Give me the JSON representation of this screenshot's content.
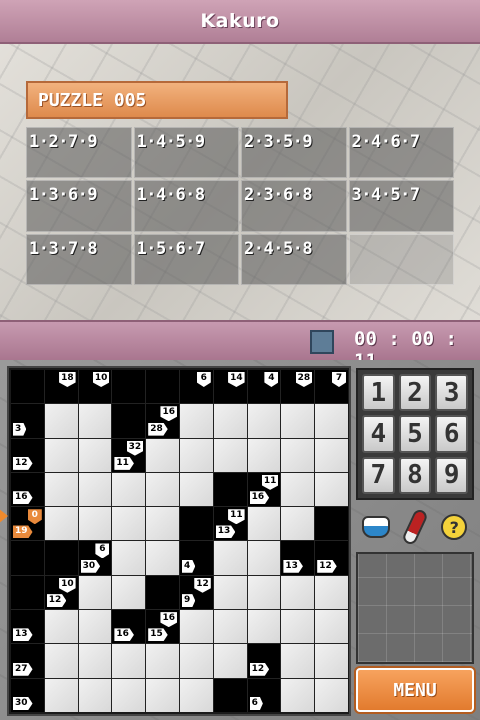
{
  "header": {
    "title": "Kakuro"
  },
  "puzzle": {
    "label": "PUZZLE 005"
  },
  "combinations": [
    "1·2·7·9",
    "1·4·5·9",
    "2·3·5·9",
    "2·4·6·7",
    "1·3·6·9",
    "1·4·6·8",
    "2·3·6·8",
    "3·4·5·7",
    "1·3·7·8",
    "1·5·6·7",
    "2·4·5·8",
    ""
  ],
  "timer": {
    "value": "00 : 00 : 11"
  },
  "keypad": {
    "keys": [
      "1",
      "2",
      "3",
      "4",
      "5",
      "6",
      "7",
      "8",
      "9"
    ]
  },
  "tools": {
    "hint_symbol": "?"
  },
  "menu": {
    "label": "MENU"
  },
  "colors": {
    "accent": "#e27b2e",
    "title_bar": "#b07f96"
  },
  "board": {
    "rows": 10,
    "cols": 10,
    "cells": [
      [
        {
          "t": "b"
        },
        {
          "t": "b",
          "d": "18"
        },
        {
          "t": "b",
          "d": "10"
        },
        {
          "t": "b"
        },
        {
          "t": "b"
        },
        {
          "t": "b",
          "d": "6"
        },
        {
          "t": "b",
          "d": "14"
        },
        {
          "t": "b",
          "d": "4"
        },
        {
          "t": "b",
          "d": "28"
        },
        {
          "t": "b",
          "d": "7"
        }
      ],
      [
        {
          "t": "b",
          "r": "3"
        },
        {
          "t": "w"
        },
        {
          "t": "w"
        },
        {
          "t": "b"
        },
        {
          "t": "b",
          "d": "16",
          "r": "28"
        },
        {
          "t": "w"
        },
        {
          "t": "w"
        },
        {
          "t": "w"
        },
        {
          "t": "w"
        },
        {
          "t": "w"
        }
      ],
      [
        {
          "t": "b",
          "r": "12"
        },
        {
          "t": "w"
        },
        {
          "t": "w"
        },
        {
          "t": "b",
          "d": "32",
          "r": "11"
        },
        {
          "t": "w"
        },
        {
          "t": "w"
        },
        {
          "t": "w"
        },
        {
          "t": "w"
        },
        {
          "t": "w"
        },
        {
          "t": "w"
        }
      ],
      [
        {
          "t": "b",
          "r": "16"
        },
        {
          "t": "w"
        },
        {
          "t": "w"
        },
        {
          "t": "w"
        },
        {
          "t": "w"
        },
        {
          "t": "w"
        },
        {
          "t": "b"
        },
        {
          "t": "b",
          "d": "11",
          "r": "16"
        },
        {
          "t": "w"
        },
        {
          "t": "w"
        }
      ],
      [
        {
          "t": "b",
          "r": "19",
          "d": "0",
          "hi": true
        },
        {
          "t": "w"
        },
        {
          "t": "w"
        },
        {
          "t": "w"
        },
        {
          "t": "w"
        },
        {
          "t": "b"
        },
        {
          "t": "b",
          "d": "11",
          "r": "13"
        },
        {
          "t": "w"
        },
        {
          "t": "w"
        },
        {
          "t": "b"
        }
      ],
      [
        {
          "t": "b"
        },
        {
          "t": "b"
        },
        {
          "t": "b",
          "d": "6",
          "r": "30"
        },
        {
          "t": "w"
        },
        {
          "t": "w"
        },
        {
          "t": "b",
          "r": "4"
        },
        {
          "t": "w"
        },
        {
          "t": "w"
        },
        {
          "t": "b",
          "r": "13"
        },
        {
          "t": "b",
          "r": "12"
        }
      ],
      [
        {
          "t": "b"
        },
        {
          "t": "b",
          "d": "10",
          "r": "12"
        },
        {
          "t": "w"
        },
        {
          "t": "w"
        },
        {
          "t": "b"
        },
        {
          "t": "b",
          "d": "12",
          "r": "9"
        },
        {
          "t": "w"
        },
        {
          "t": "w"
        },
        {
          "t": "w"
        },
        {
          "t": "w"
        }
      ],
      [
        {
          "t": "b",
          "r": "13"
        },
        {
          "t": "w"
        },
        {
          "t": "w"
        },
        {
          "t": "b",
          "r": "16"
        },
        {
          "t": "b",
          "d": "16",
          "r": "15"
        },
        {
          "t": "w"
        },
        {
          "t": "w"
        },
        {
          "t": "w"
        },
        {
          "t": "w"
        },
        {
          "t": "w"
        }
      ],
      [
        {
          "t": "b",
          "r": "27"
        },
        {
          "t": "w"
        },
        {
          "t": "w"
        },
        {
          "t": "w"
        },
        {
          "t": "w"
        },
        {
          "t": "w"
        },
        {
          "t": "w"
        },
        {
          "t": "b",
          "r": "12"
        },
        {
          "t": "w"
        },
        {
          "t": "w"
        }
      ],
      [
        {
          "t": "b",
          "r": "30"
        },
        {
          "t": "w"
        },
        {
          "t": "w"
        },
        {
          "t": "w"
        },
        {
          "t": "w"
        },
        {
          "t": "w"
        },
        {
          "t": "b"
        },
        {
          "t": "b",
          "r": "6"
        },
        {
          "t": "w"
        },
        {
          "t": "w"
        }
      ]
    ]
  }
}
